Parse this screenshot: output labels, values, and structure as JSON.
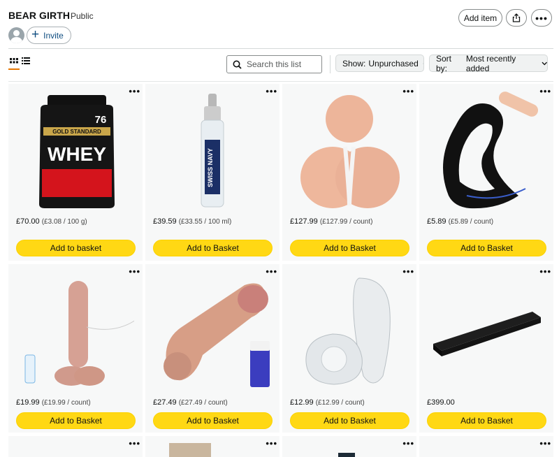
{
  "header": {
    "list_title": "BEAR GIRTH",
    "visibility": "Public",
    "invite_label": "Invite",
    "add_item_label": "Add item",
    "more_label": "•••"
  },
  "toolbar": {
    "search_placeholder": "Search this list",
    "show_label": "Show:",
    "show_value": "Unpurchased",
    "sort_label": "Sort by:",
    "sort_value": "Most recently added",
    "accent_color": "#e77600"
  },
  "products": [
    {
      "price": "£70.00",
      "unit_price": "(£3.08 / 100 g)",
      "button": "Add to basket",
      "image": "whey-protein-tub",
      "more": "•••"
    },
    {
      "price": "£39.59",
      "unit_price": "(£33.55 / 100 ml)",
      "button": "Add to Basket",
      "image": "lubricant-bottle",
      "more": "•••"
    },
    {
      "price": "£127.99",
      "unit_price": "(£127.99 / count)",
      "button": "Add to Basket",
      "image": "torso-product",
      "more": "•••"
    },
    {
      "price": "£5.89",
      "unit_price": "(£5.89 / count)",
      "button": "Add to Basket",
      "image": "black-ring",
      "more": "•••"
    },
    {
      "price": "£19.99",
      "unit_price": "(£19.99 / count)",
      "button": "Add to Basket",
      "image": "clear-toy",
      "more": "•••"
    },
    {
      "price": "£27.49",
      "unit_price": "(£27.49 / count)",
      "button": "Add to Basket",
      "image": "skin-tone-toy",
      "more": "•••"
    },
    {
      "price": "£12.99",
      "unit_price": "(£12.99 / count)",
      "button": "Add to Basket",
      "image": "clear-sleeve",
      "more": "•••"
    },
    {
      "price": "£399.00",
      "unit_price": "",
      "button": "Add to Basket",
      "image": "soundbar",
      "more": "•••"
    }
  ],
  "colors": {
    "button_yellow": "#ffd814",
    "card_bg": "#f7f8f8",
    "link_blue": "#0f4d80"
  }
}
